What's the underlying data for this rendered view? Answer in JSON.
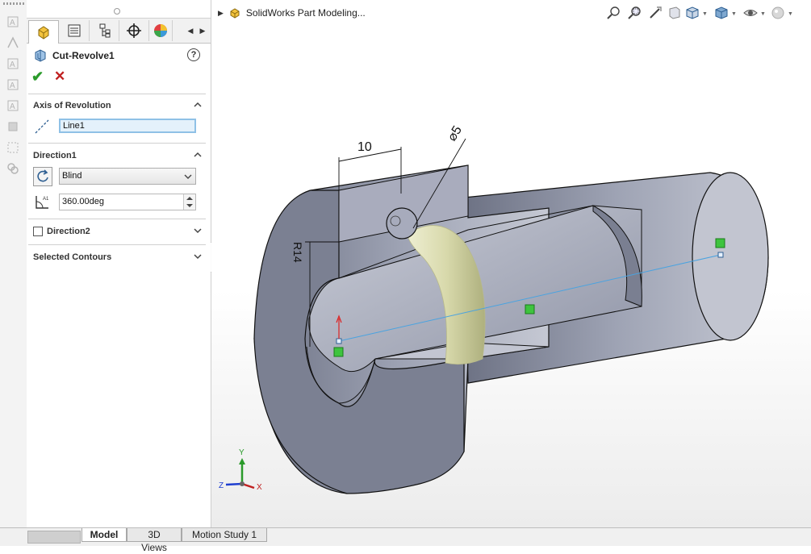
{
  "feature": {
    "title": "Cut-Revolve1",
    "help_label": "?"
  },
  "actions": {
    "ok_glyph": "✔",
    "cancel_glyph": "✕"
  },
  "sections": {
    "axis": {
      "label": "Axis of Revolution",
      "value": "Line1"
    },
    "direction1": {
      "label": "Direction1",
      "end_condition": "Blind",
      "angle": "360.00deg"
    },
    "direction2": {
      "label": "Direction2",
      "checked": false
    },
    "contours": {
      "label": "Selected Contours"
    }
  },
  "viewport": {
    "tree_title": "SolidWorks Part Modeling...",
    "dimensions": {
      "width_dim": "10",
      "diameter_dim": "⌀5",
      "radius_dim": "R14"
    },
    "triad": {
      "x": "X",
      "y": "Y",
      "z": "Z"
    }
  },
  "bottom_tabs": [
    "Model",
    "3D Views",
    "Motion Study 1"
  ],
  "colors": {
    "body": "#9aa0b2",
    "body_dark": "#6c7183",
    "profile": "#d6d7a8",
    "accent": "#2b9b2b",
    "cancel": "#c02020",
    "axis_line": "#4aa3e0"
  },
  "icons": {
    "pm_tabs": [
      "feature-manager-icon",
      "property-manager-icon",
      "configuration-manager-icon",
      "dimxpert-icon",
      "display-manager-icon"
    ],
    "heads_up": [
      "zoom-to-fit-icon",
      "zoom-area-icon",
      "previous-view-icon",
      "section-view-icon",
      "view-orientation-icon",
      "display-style-icon",
      "hide-show-icon",
      "appearance-icon"
    ]
  }
}
